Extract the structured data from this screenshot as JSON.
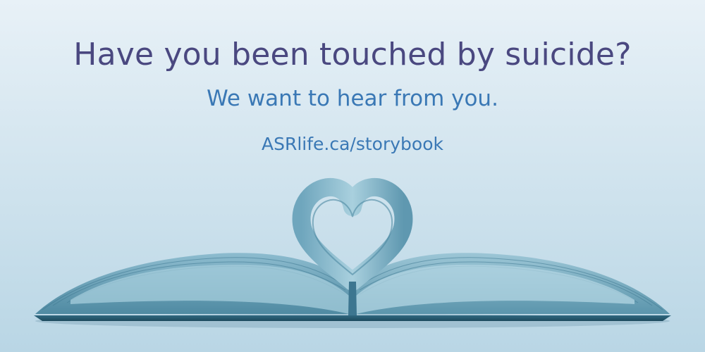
{
  "banner": {
    "headline": "Have you been touched by suicide?",
    "subhead": "We want to hear from you.",
    "url": "ASRlife.ca/storybook"
  },
  "colors": {
    "background_top": "#e8f1f7",
    "background_bottom": "#b9d6e5",
    "headline": "#4a4880",
    "accent": "#3a78b5",
    "book_dark": "#2c6278",
    "book_light": "#7fb1c6"
  },
  "image": {
    "icon": "open-book-heart-pages-icon"
  }
}
